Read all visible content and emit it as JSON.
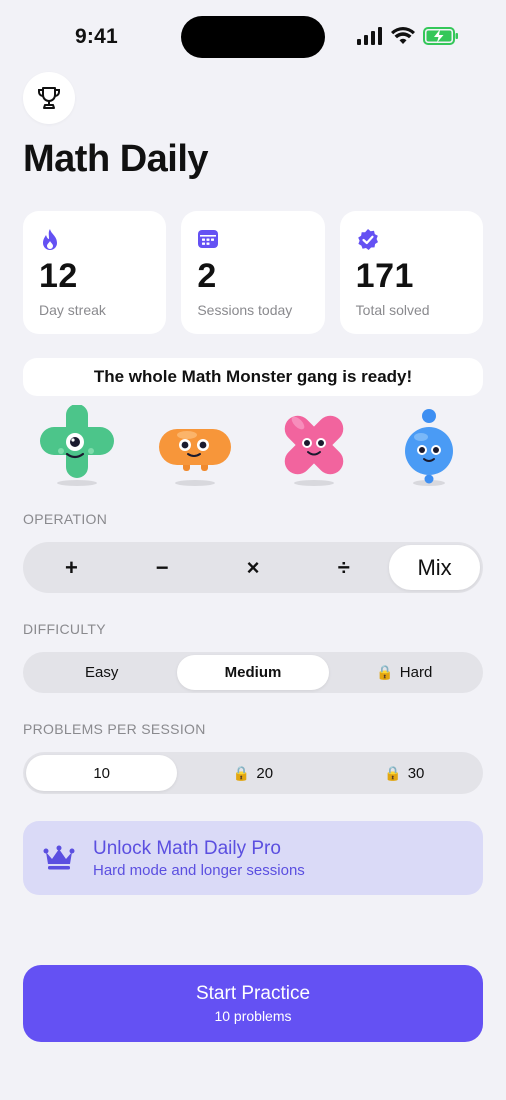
{
  "status_bar": {
    "time": "9:41"
  },
  "header": {
    "title": "Math Daily",
    "trophy_icon": "trophy-icon"
  },
  "stats": [
    {
      "icon": "flame-icon",
      "value": "12",
      "label": "Day streak"
    },
    {
      "icon": "calendar-icon",
      "value": "2",
      "label": "Sessions today"
    },
    {
      "icon": "verified-badge-icon",
      "value": "171",
      "label": "Total solved"
    }
  ],
  "gang_banner": "The whole Math Monster gang is ready!",
  "monsters": [
    "green-plus-monster",
    "orange-minus-monster",
    "pink-times-monster",
    "blue-divide-monster"
  ],
  "operation": {
    "label": "OPERATION",
    "options": [
      "+",
      "−",
      "×",
      "÷",
      "Mix"
    ],
    "selected": "Mix"
  },
  "difficulty": {
    "label": "DIFFICULTY",
    "options": [
      "Easy",
      "Medium",
      "Hard"
    ],
    "selected": "Medium",
    "locked": [
      "Hard"
    ]
  },
  "problems_per_session": {
    "label": "PROBLEMS PER SESSION",
    "options": [
      "10",
      "20",
      "30"
    ],
    "selected": "10",
    "locked": [
      "20",
      "30"
    ]
  },
  "pro_banner": {
    "title": "Unlock Math Daily Pro",
    "subtitle": "Hard mode and longer sessions",
    "icon": "crown-icon"
  },
  "start_button": {
    "title": "Start Practice",
    "subtitle": "10 problems"
  },
  "colors": {
    "accent": "#6451F3",
    "background": "#F2F2F7",
    "pro_bg": "#DADAF7",
    "pro_text": "#5B4FE0"
  },
  "lock_glyph": "🔒"
}
